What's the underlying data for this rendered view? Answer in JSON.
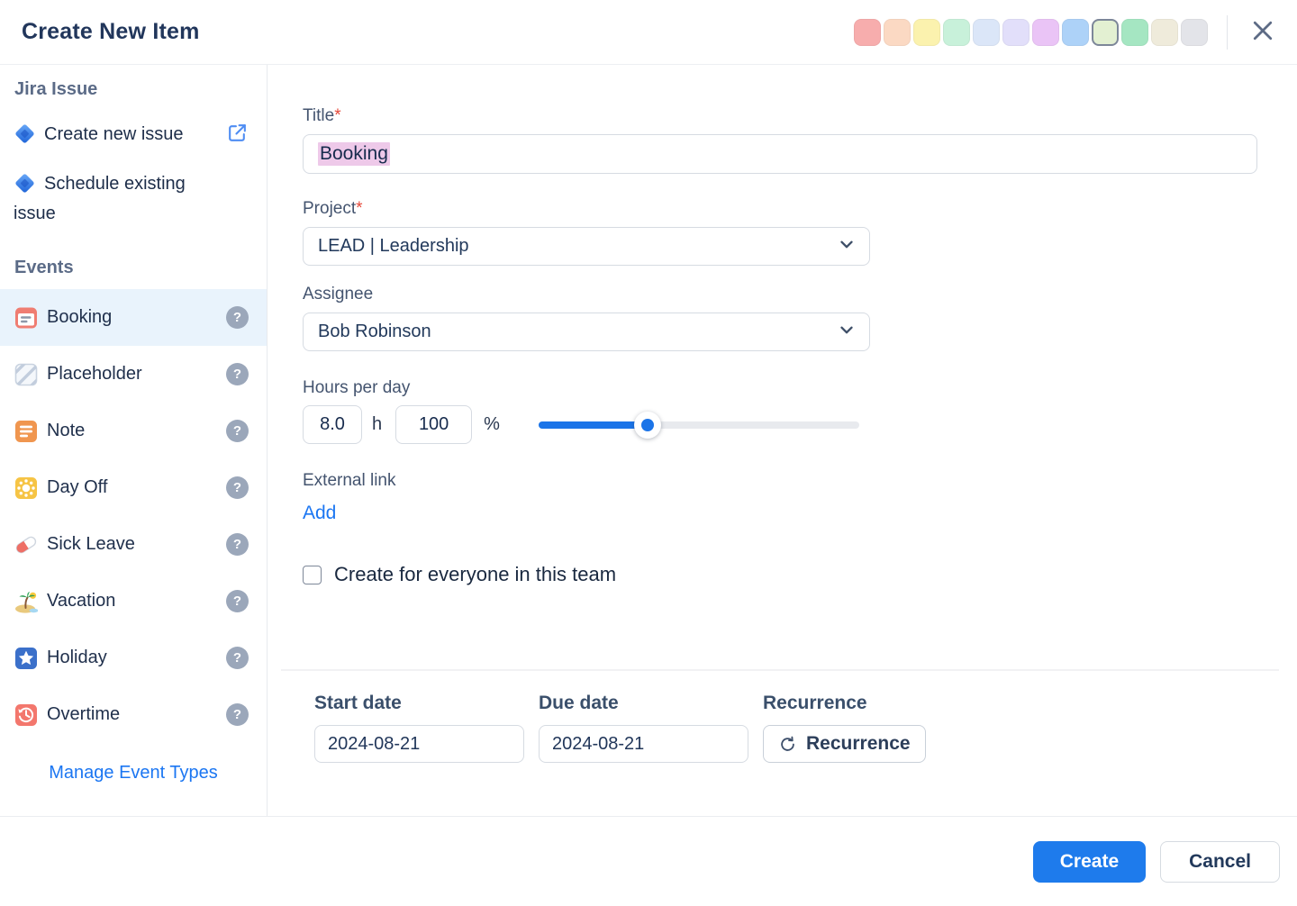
{
  "header": {
    "title": "Create New Item",
    "swatches": [
      {
        "color": "#f7adad",
        "selected": false
      },
      {
        "color": "#fbd9c3",
        "selected": false
      },
      {
        "color": "#fbf2ae",
        "selected": false
      },
      {
        "color": "#c8f1da",
        "selected": false
      },
      {
        "color": "#dbe6f8",
        "selected": false
      },
      {
        "color": "#e2dffa",
        "selected": false
      },
      {
        "color": "#eac4f6",
        "selected": false
      },
      {
        "color": "#add2f8",
        "selected": false
      },
      {
        "color": "#e3f0d2",
        "selected": true
      },
      {
        "color": "#a5e6c2",
        "selected": false
      },
      {
        "color": "#efebdb",
        "selected": false
      },
      {
        "color": "#e3e4e9",
        "selected": false
      }
    ]
  },
  "sidebar": {
    "jira_section": {
      "title": "Jira Issue",
      "items": [
        {
          "label": "Create new issue",
          "icon": "jira-icon",
          "trailing_icon": "external-link-icon"
        },
        {
          "label": "Schedule existing issue",
          "icon": "jira-icon"
        }
      ]
    },
    "events_section": {
      "title": "Events",
      "help_glyph": "?",
      "items": [
        {
          "label": "Booking",
          "icon": "booking-icon",
          "selected": true
        },
        {
          "label": "Placeholder",
          "icon": "placeholder-icon",
          "selected": false
        },
        {
          "label": "Note",
          "icon": "note-icon",
          "selected": false
        },
        {
          "label": "Day Off",
          "icon": "dayoff-icon",
          "selected": false
        },
        {
          "label": "Sick Leave",
          "icon": "sickleave-icon",
          "selected": false
        },
        {
          "label": "Vacation",
          "icon": "vacation-icon",
          "selected": false
        },
        {
          "label": "Holiday",
          "icon": "holiday-icon",
          "selected": false
        },
        {
          "label": "Overtime",
          "icon": "overtime-icon",
          "selected": false
        }
      ]
    },
    "manage_link": "Manage Event Types"
  },
  "form": {
    "required_mark": "*",
    "title_field": {
      "label": "Title",
      "value": "Booking"
    },
    "project_field": {
      "label": "Project",
      "value": "LEAD | Leadership"
    },
    "assignee_field": {
      "label": "Assignee",
      "value": "Bob Robinson"
    },
    "hours_field": {
      "label": "Hours per day",
      "hours_value": "8.0",
      "hours_unit": "h",
      "percent_value": "100",
      "percent_unit": "%",
      "slider_percent": 34
    },
    "external_link": {
      "label": "External link",
      "add_label": "Add"
    },
    "team_checkbox": {
      "label": "Create for everyone in this team",
      "checked": false
    },
    "dates": {
      "start": {
        "label": "Start date",
        "value": "2024-08-21"
      },
      "due": {
        "label": "Due date",
        "value": "2024-08-21"
      },
      "recurrence": {
        "label": "Recurrence",
        "button_label": "Recurrence"
      }
    }
  },
  "footer": {
    "create_label": "Create",
    "cancel_label": "Cancel"
  },
  "colors": {
    "accent_blue": "#1e7bec",
    "link_blue": "#1b76f2",
    "selected_row_bg": "#e9f3fc",
    "text_selection": "#eec9e9",
    "selected_swatch_border": "#7d8799"
  }
}
